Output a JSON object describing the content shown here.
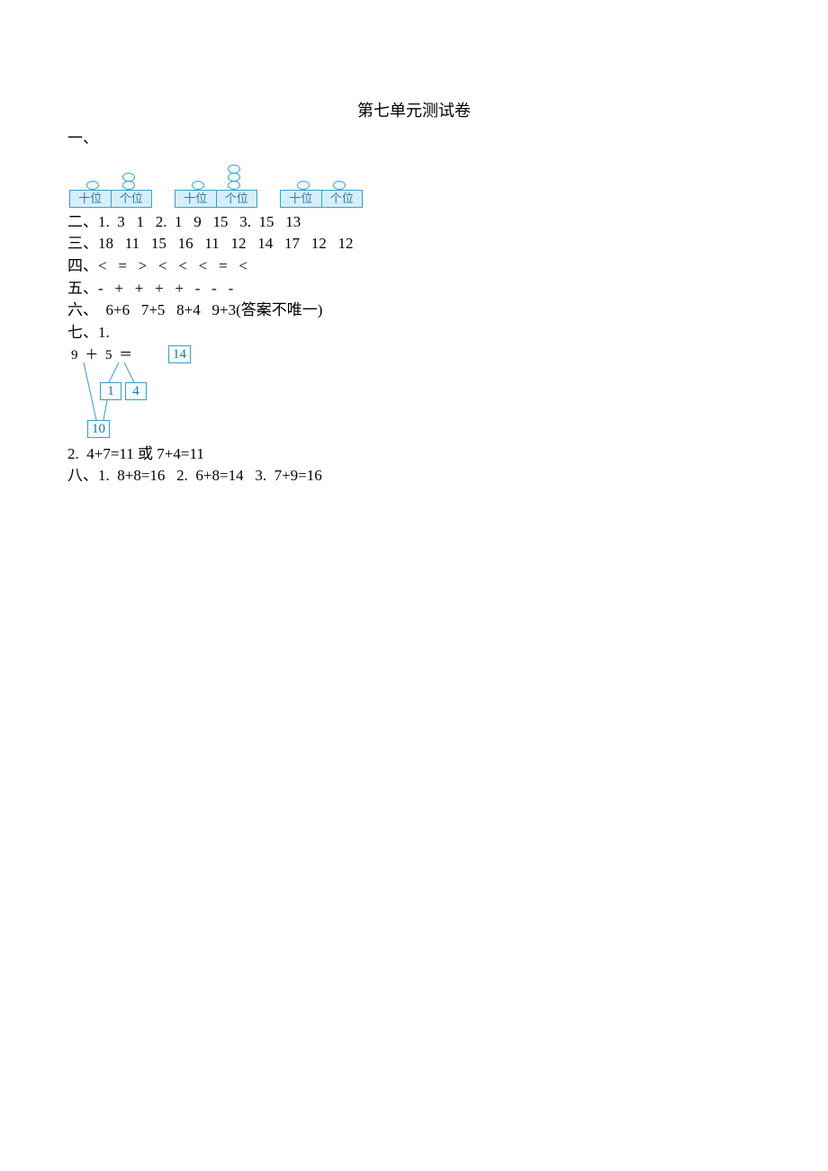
{
  "title": "第七单元测试卷",
  "sec1_label": "一、",
  "abacus_label_tens": "十位",
  "abacus_label_ones": "个位",
  "abacuses": [
    {
      "tens": 1,
      "ones": 2
    },
    {
      "tens": 1,
      "ones": 3
    },
    {
      "tens": 1,
      "ones": 1
    }
  ],
  "sec2": "二、1.  3   1   2.  1   9   15   3.  15   13",
  "sec3": "三、18   11   15   16   11   12   14   17   12   12",
  "sec4": "四、<   =   >   <   <   <   =   <",
  "sec5": "五、-   +   +   +   +   -   -   -",
  "sec6": "六、  6+6   7+5   8+4   9+3(答案不唯一)",
  "sec7_label": "七、1.",
  "bond": {
    "expr": "9 ＋ 5 ＝",
    "answer": "14",
    "split1": "1",
    "split2": "4",
    "sum": "10"
  },
  "sec7_2": "2.  4+7=11 或 7+4=11",
  "sec8": "八、1.  8+8=16   2.  6+8=14   3.  7+9=16"
}
